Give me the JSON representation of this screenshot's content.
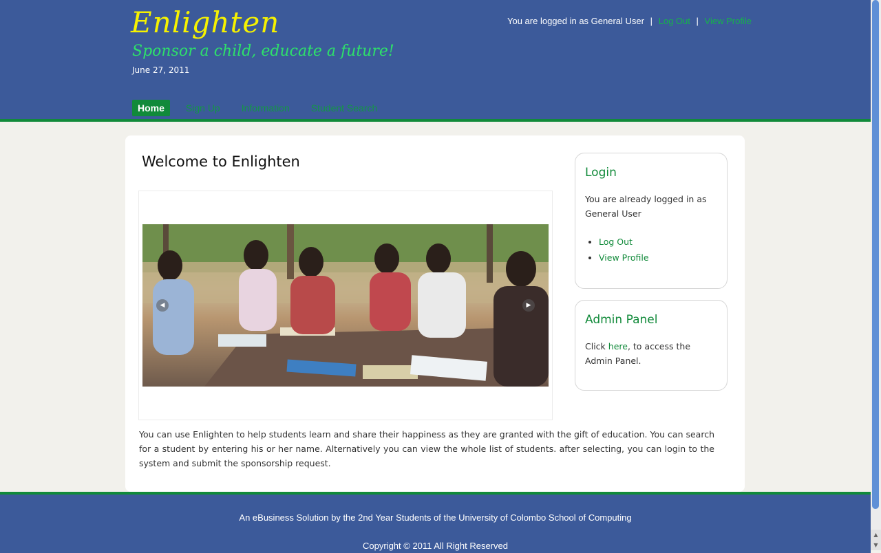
{
  "site": {
    "logo": "Enlighten",
    "tagline": "Sponsor a child, educate a future!",
    "date": "June 27, 2011"
  },
  "userbar": {
    "logged_in_text": "You are logged in as General User",
    "separator": "|",
    "logout": "Log Out",
    "view_profile": "View Profile"
  },
  "nav": {
    "home": "Home",
    "signup": "Sign Up",
    "information": "Information",
    "student_search": "Student Search"
  },
  "main": {
    "title": "Welcome to Enlighten",
    "intro": "You can use Enlighten to help students learn and share their happiness as they are granted with the gift of education. You can search for a student by entering his or her name. Alternatively you can view the whole list of students. after selecting, you can login to the system and submit the sponsorship request."
  },
  "slider": {
    "prev_icon": "chevron-left-icon",
    "next_icon": "chevron-right-icon"
  },
  "login_box": {
    "title": "Login",
    "message": "You are already logged in as General User",
    "links": [
      "Log Out",
      "View Profile"
    ]
  },
  "admin_box": {
    "title": "Admin Panel",
    "text_before": "Click ",
    "link": "here",
    "text_after": ", to access the Admin Panel."
  },
  "footer": {
    "line1": "An eBusiness Solution by the 2nd Year Students of the University of Colombo School of Computing",
    "line2": "Copyright © 2011 All Right Reserved"
  },
  "colors": {
    "header_bg": "#3c5a9a",
    "accent_green": "#118a3a",
    "logo_yellow": "#f6f200",
    "tagline_green": "#2ee06a"
  }
}
